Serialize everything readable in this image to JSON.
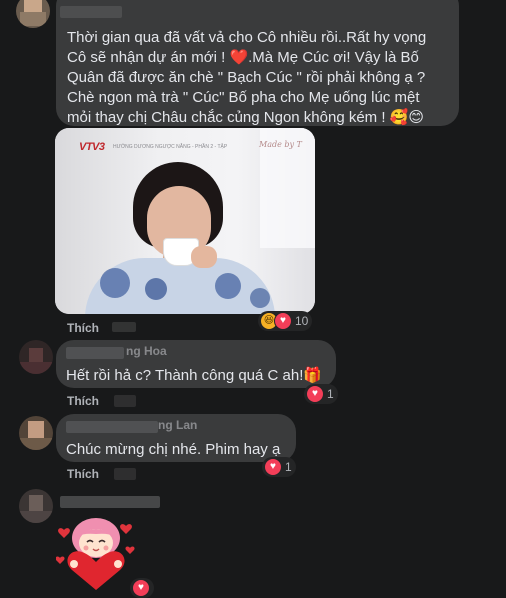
{
  "comments": [
    {
      "lines": [
        "Thời gian qua đã vất vả cho Cô nhiều rồi..Rất hy vọng",
        "Cô sẽ nhận dự án mới ! ❤️.Mà Mẹ Cúc ơi! Vậy là Bố",
        "Quân đã được ăn chè \" Bạch Cúc \" rồi phải không ạ ?",
        "Chè ngon mà trà \" Cúc\" Bố pha cho Mẹ uống lúc mệt",
        "mỏi thay chị Châu chắc củng Ngon không kém ! 🥰😊"
      ],
      "like_label": "Thích",
      "reaction_count": "10",
      "reaction_icons": [
        "haha-icon",
        "heart-icon"
      ],
      "image": {
        "logo": "VTV3",
        "caption_small": "HƯỚNG DƯƠNG NGƯỢC NẮNG - PHẦN 2 - TẬP",
        "watermark": "Made by T"
      }
    },
    {
      "name_fragment": "ng Hoa",
      "text": "Hết rồi hả c? Thành công quá C ah!🎁",
      "like_label": "Thích",
      "reaction_count": "1",
      "reaction_icons": [
        "heart-icon"
      ]
    },
    {
      "name_fragment": "ng Lan",
      "text": "Chúc mừng chị nhé. Phim hay ạ",
      "like_label": "Thích",
      "reaction_count": "1",
      "reaction_icons": [
        "heart-icon"
      ]
    },
    {
      "sticker": "heart-hug-sticker",
      "reaction_icons": [
        "heart-icon"
      ]
    }
  ],
  "colors": {
    "background": "#18191a",
    "bubble": "#3a3b3c",
    "text": "#e4e6eb",
    "secondary_text": "#b0b3b8",
    "heart": "#f33e58"
  }
}
